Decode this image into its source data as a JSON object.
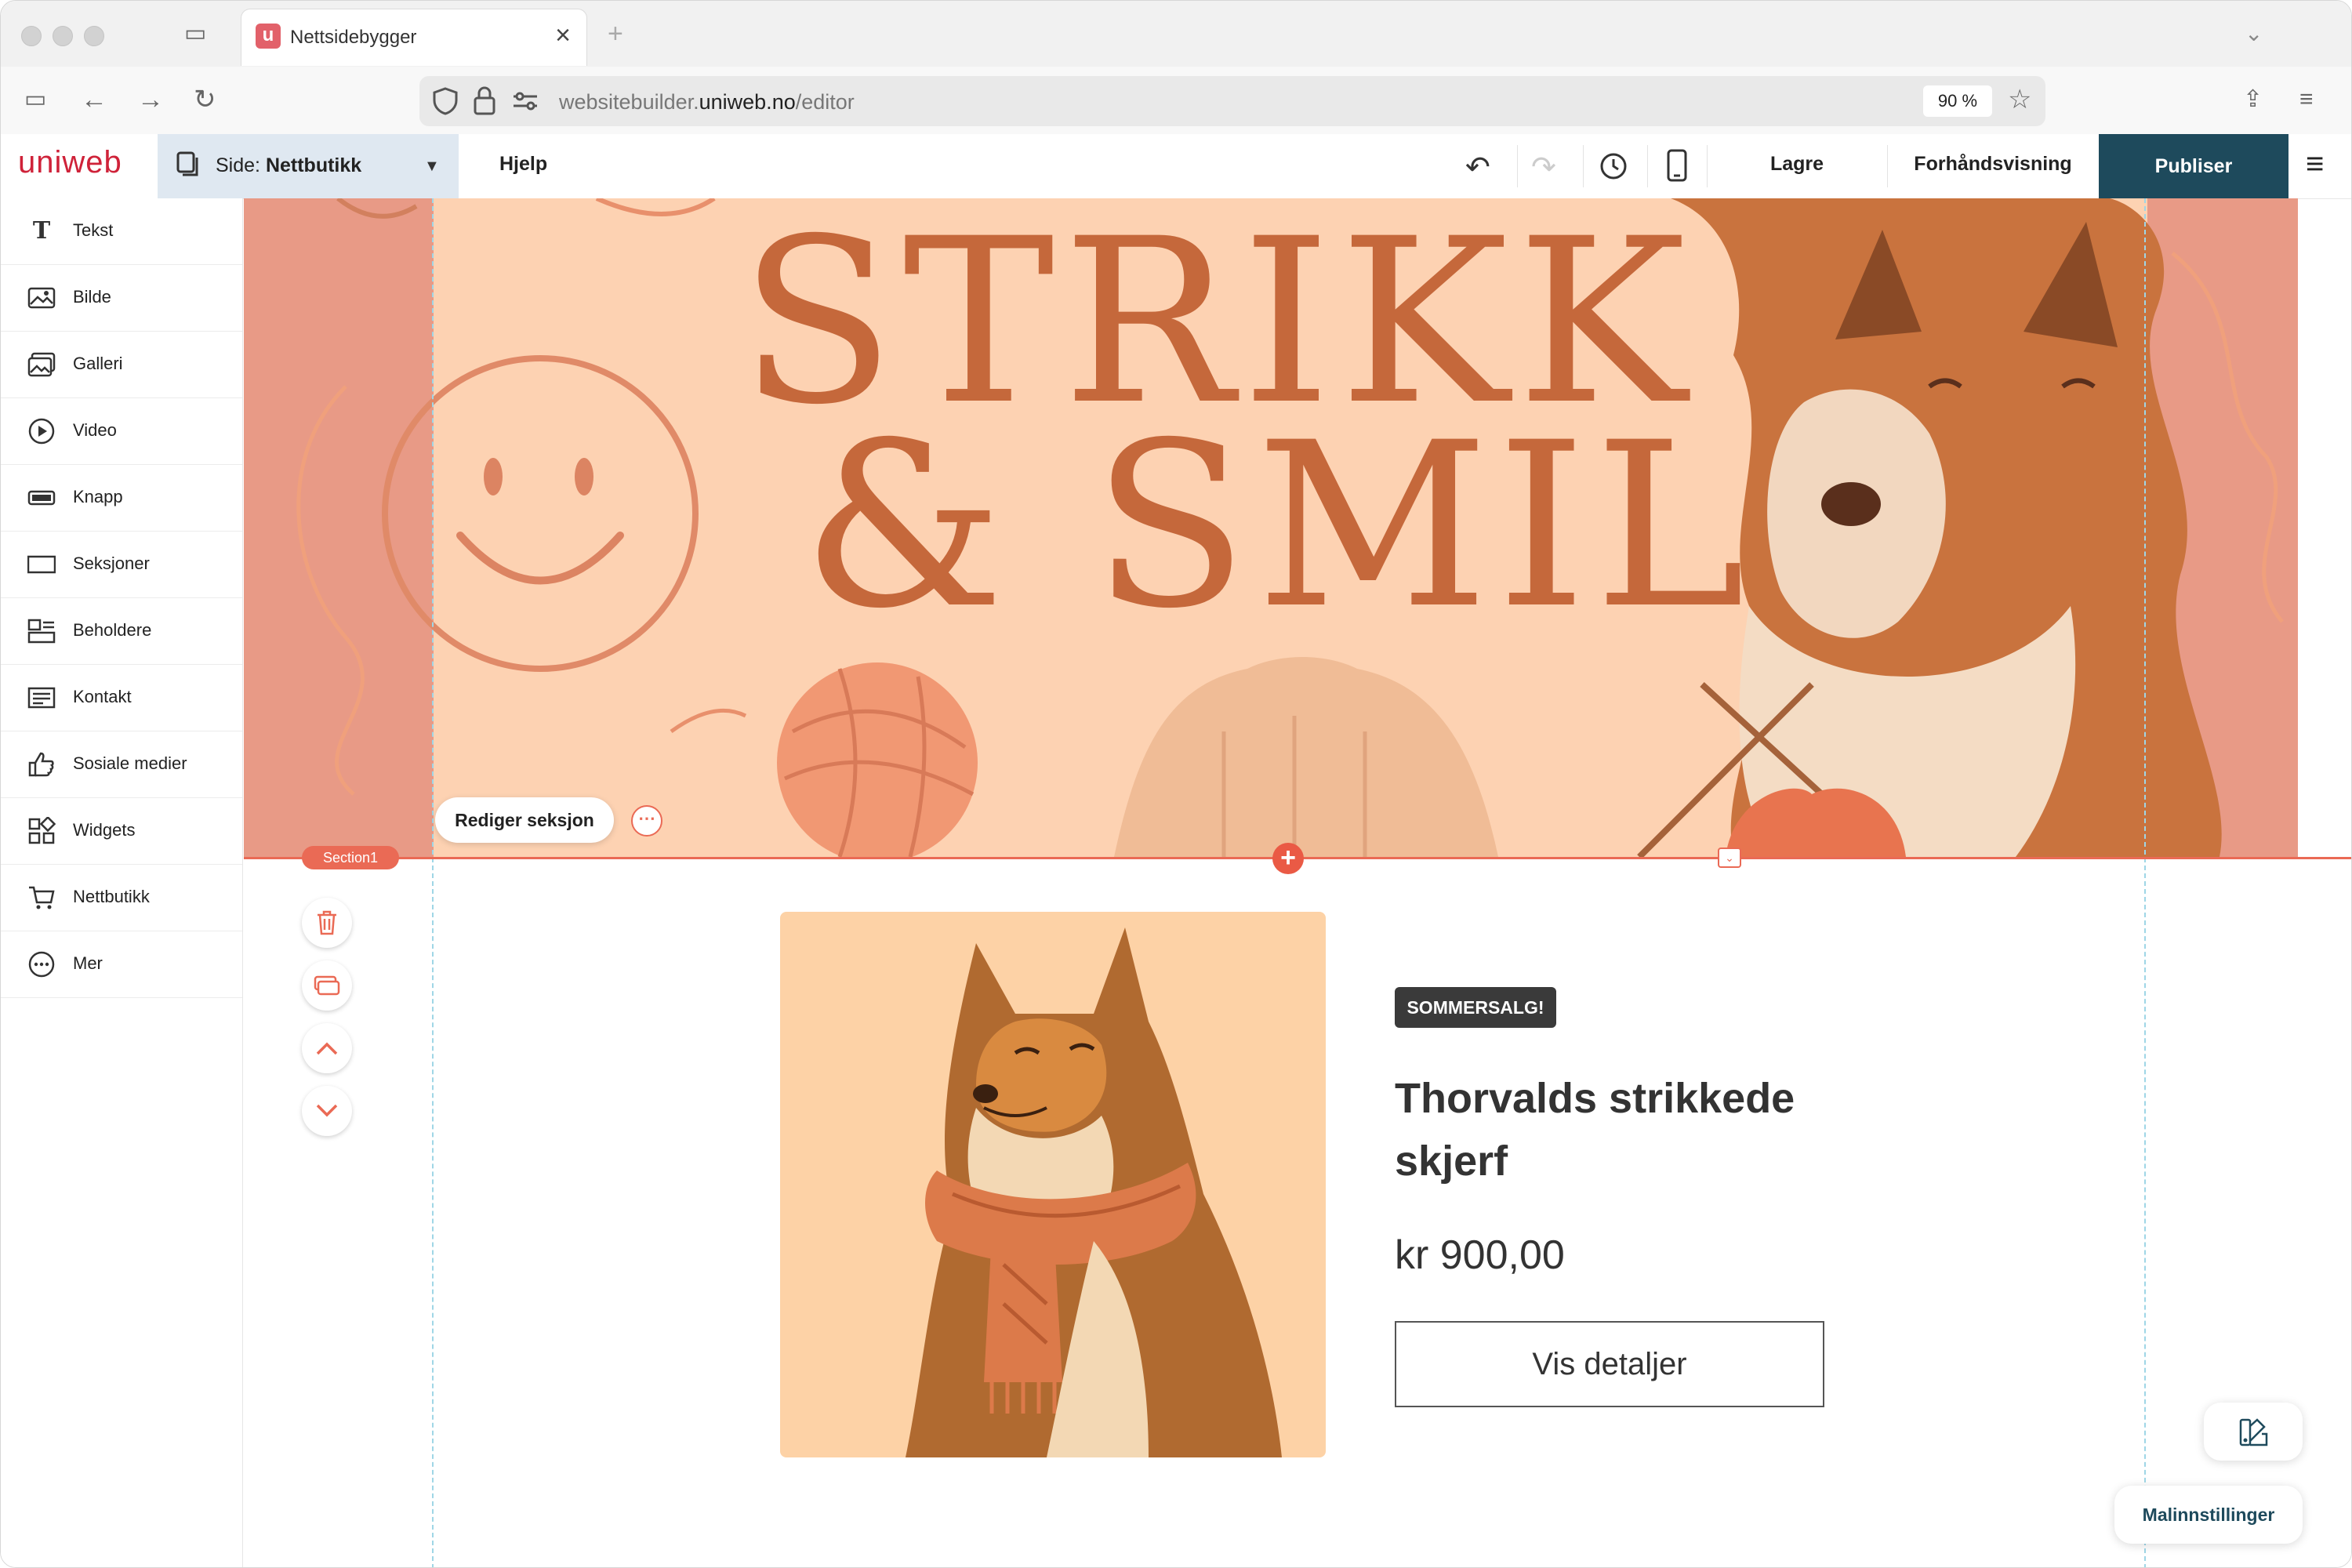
{
  "browser": {
    "tab_title": "Nettsidebygger",
    "tab_favicon": "u",
    "url_prefix": "websitebuilder.",
    "url_domain": "uniweb.no",
    "url_path": "/editor",
    "zoom": "90 %"
  },
  "editor": {
    "logo": "uniweb",
    "page_label": "Side: ",
    "page_name": "Nettbutikk",
    "help": "Hjelp",
    "save": "Lagre",
    "preview": "Forhåndsvisning",
    "publish": "Publiser"
  },
  "sidebar": {
    "items": [
      {
        "label": "Tekst",
        "icon": "text-icon"
      },
      {
        "label": "Bilde",
        "icon": "image-icon"
      },
      {
        "label": "Galleri",
        "icon": "gallery-icon"
      },
      {
        "label": "Video",
        "icon": "video-icon"
      },
      {
        "label": "Knapp",
        "icon": "button-icon"
      },
      {
        "label": "Seksjoner",
        "icon": "sections-icon"
      },
      {
        "label": "Beholdere",
        "icon": "containers-icon"
      },
      {
        "label": "Kontakt",
        "icon": "contact-icon"
      },
      {
        "label": "Sosiale medier",
        "icon": "thumbs-up-icon"
      },
      {
        "label": "Widgets",
        "icon": "widgets-icon"
      },
      {
        "label": "Nettbutikk",
        "icon": "cart-icon"
      },
      {
        "label": "Mer",
        "icon": "more-icon"
      }
    ]
  },
  "hero": {
    "line1": "STRIKK",
    "line2": "& SMIL"
  },
  "section": {
    "edit_label": "Rediger seksjon",
    "tag": "Section1"
  },
  "product": {
    "badge": "SOMMERSALG!",
    "title": "Thorvalds strikkede skjerf",
    "price": "kr 900,00",
    "button": "Vis detaljer"
  },
  "template_settings": "Malinnstillinger",
  "colors": {
    "accent": "#ea6a55",
    "publish_bg": "#1e4a5c",
    "brand": "#cf2239"
  }
}
